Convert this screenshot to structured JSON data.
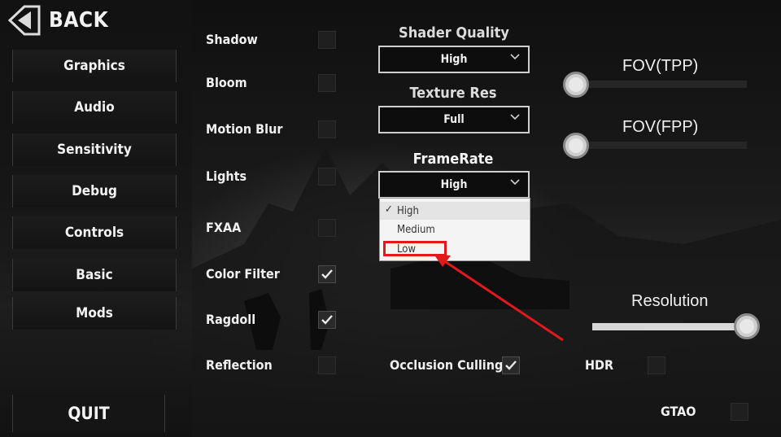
{
  "nav": {
    "back_label": "BACK",
    "menu_items": [
      "Graphics",
      "Audio",
      "Sensitivity",
      "Debug",
      "Controls",
      "Basic",
      "Mods"
    ],
    "quit_label": "QUIT"
  },
  "toggles": {
    "shadow": {
      "label": "Shadow",
      "checked": false
    },
    "bloom": {
      "label": "Bloom",
      "checked": false
    },
    "motion_blur": {
      "label": "Motion Blur",
      "checked": false
    },
    "lights": {
      "label": "Lights",
      "checked": false
    },
    "fxaa": {
      "label": "FXAA",
      "checked": false
    },
    "color_filter": {
      "label": "Color Filter",
      "checked": true
    },
    "ragdoll": {
      "label": "Ragdoll",
      "checked": true
    },
    "reflection": {
      "label": "Reflection",
      "checked": false
    },
    "occlusion_culling": {
      "label": "Occlusion Culling",
      "checked": true
    },
    "hdr": {
      "label": "HDR",
      "checked": false
    },
    "gtao": {
      "label": "GTAO",
      "checked": false
    }
  },
  "dropdowns": {
    "shader_quality": {
      "title": "Shader Quality",
      "value": "High"
    },
    "texture_res": {
      "title": "Texture Res",
      "value": "Full"
    },
    "frame_rate": {
      "title": "FrameRate",
      "value": "High",
      "options": [
        "High",
        "Medium",
        "Low"
      ],
      "selected": "High",
      "highlighted": "Low"
    }
  },
  "sliders": {
    "fov_tpp": {
      "label": "FOV(TPP)",
      "value_fraction": 0.0
    },
    "fov_fpp": {
      "label": "FOV(FPP)",
      "value_fraction": 0.0
    },
    "resolution": {
      "label": "Resolution",
      "value_fraction": 1.0
    }
  },
  "colors": {
    "annotation": "#e11919",
    "panel": "#151515",
    "knob": "#cfcfcf"
  },
  "icons": {
    "back": "back-arrow-icon",
    "check": "checkmark-icon",
    "dropdown": "chevron-down-icon"
  }
}
